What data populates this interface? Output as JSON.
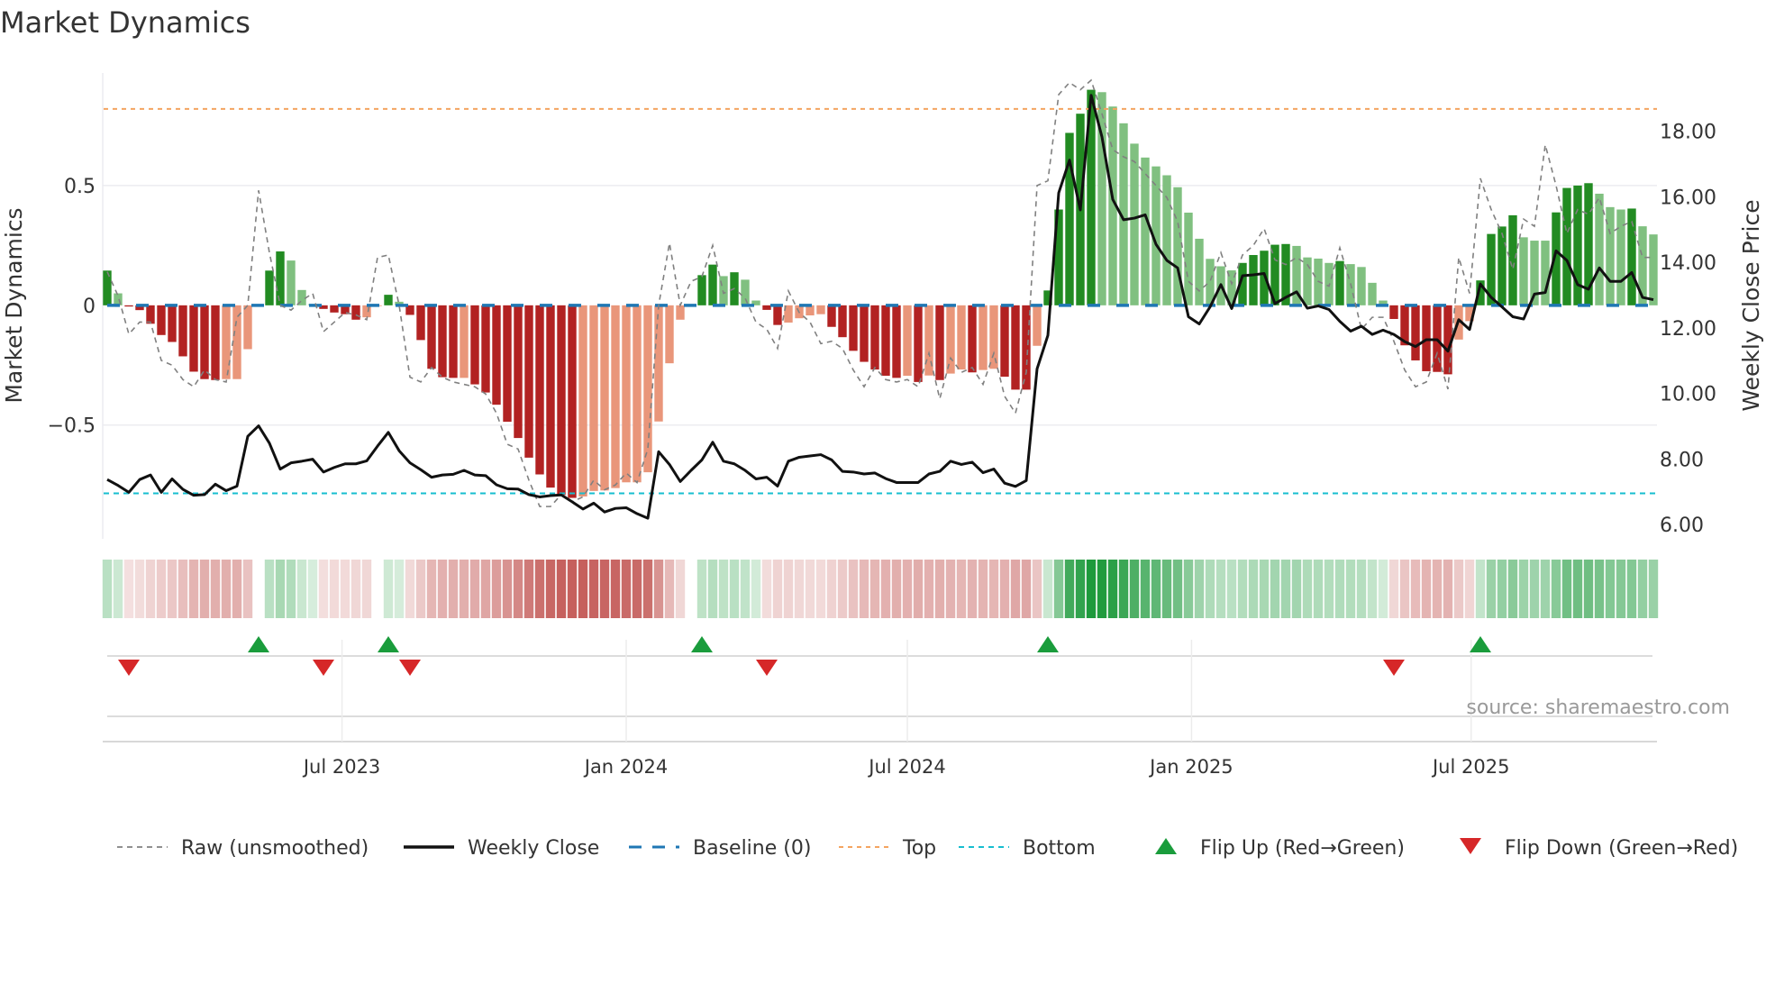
{
  "title": "Market Dynamics",
  "source": "source: sharemaestro.com",
  "chart_data": {
    "type": "bar",
    "title": "Market Dynamics",
    "ylabel": "Market Dynamics",
    "y2label": "Weekly Close Price",
    "start_date": "2023-01-30",
    "frequency": "weekly",
    "ylim": [
      -0.975,
      0.97
    ],
    "y2lim": [
      5.56,
      19.78
    ],
    "yticks": [
      {
        "v": 0.5,
        "label": "0.5"
      },
      {
        "v": 0,
        "label": "0"
      },
      {
        "v": -0.5,
        "label": "−0.5"
      }
    ],
    "y2ticks": [
      {
        "v": 6,
        "label": "6.00"
      },
      {
        "v": 8,
        "label": "8.00"
      },
      {
        "v": 10,
        "label": "10.00"
      },
      {
        "v": 12,
        "label": "12.00"
      },
      {
        "v": 14,
        "label": "14.00"
      },
      {
        "v": 16,
        "label": "16.00"
      },
      {
        "v": 18,
        "label": "18.00"
      }
    ],
    "xticks": [
      {
        "date": "2023-07-01",
        "label": "Jul 2023"
      },
      {
        "date": "2024-01-01",
        "label": "Jan 2024"
      },
      {
        "date": "2024-07-01",
        "label": "Jul 2024"
      },
      {
        "date": "2025-01-01",
        "label": "Jan 2025"
      },
      {
        "date": "2025-07-01",
        "label": "Jul 2025"
      }
    ],
    "top_level": 0.82,
    "bottom_level": -0.785,
    "baseline": 0,
    "colors": {
      "dg": "#228b22",
      "lg": "#80c080",
      "dr": "#b22222",
      "lr": "#e9967a",
      "raw": "#808080",
      "close": "#111111",
      "baseline": "#1f77b4",
      "top": "#f4a460",
      "bottom": "#17becf",
      "flip_up": "#1a9c3c",
      "flip_down": "#d62728",
      "strip_green": "#1e9a3c",
      "strip_red": "#c0504d"
    },
    "smoothed": [
      0.145,
      0.05,
      -0.005,
      -0.02,
      -0.077,
      -0.124,
      -0.153,
      -0.213,
      -0.277,
      -0.308,
      -0.312,
      -0.308,
      -0.308,
      -0.183,
      0,
      0.145,
      0.225,
      0.187,
      0.064,
      0.005,
      -0.015,
      -0.03,
      -0.037,
      -0.06,
      -0.05,
      0,
      0.044,
      0.015,
      -0.04,
      -0.145,
      -0.265,
      -0.3,
      -0.303,
      -0.303,
      -0.33,
      -0.364,
      -0.415,
      -0.486,
      -0.554,
      -0.636,
      -0.706,
      -0.761,
      -0.792,
      -0.804,
      -0.798,
      -0.775,
      -0.773,
      -0.763,
      -0.739,
      -0.739,
      -0.697,
      -0.485,
      -0.242,
      -0.06,
      0,
      0.126,
      0.17,
      0.122,
      0.138,
      0.107,
      0.02,
      -0.019,
      -0.082,
      -0.072,
      -0.054,
      -0.042,
      -0.037,
      -0.09,
      -0.133,
      -0.19,
      -0.236,
      -0.268,
      -0.294,
      -0.303,
      -0.294,
      -0.32,
      -0.293,
      -0.312,
      -0.285,
      -0.268,
      -0.28,
      -0.27,
      -0.265,
      -0.298,
      -0.352,
      -0.352,
      -0.169,
      0.062,
      0.4,
      0.72,
      0.8,
      0.9,
      0.89,
      0.83,
      0.76,
      0.675,
      0.617,
      0.58,
      0.543,
      0.493,
      0.387,
      0.278,
      0.194,
      0.163,
      0.146,
      0.177,
      0.21,
      0.228,
      0.253,
      0.256,
      0.248,
      0.2,
      0.195,
      0.177,
      0.185,
      0.172,
      0.16,
      0.094,
      0.02,
      -0.057,
      -0.167,
      -0.23,
      -0.275,
      -0.278,
      -0.288,
      -0.143,
      -0.066,
      0.104,
      0.298,
      0.329,
      0.376,
      0.284,
      0.27,
      0.27,
      0.388,
      0.49,
      0.5,
      0.51,
      0.466,
      0.41,
      0.4,
      0.404,
      0.33,
      0.296
    ],
    "bar_color": [
      "dg",
      "lg",
      "dr",
      "dr",
      "dr",
      "dr",
      "dr",
      "dr",
      "dr",
      "dr",
      "dr",
      "lr",
      "lr",
      "lr",
      "lg",
      "dg",
      "dg",
      "lg",
      "lg",
      "lg",
      "dr",
      "dr",
      "dr",
      "dr",
      "lr",
      "lr",
      "dg",
      "lg",
      "dr",
      "dr",
      "dr",
      "dr",
      "dr",
      "lr",
      "dr",
      "dr",
      "dr",
      "dr",
      "dr",
      "dr",
      "dr",
      "dr",
      "dr",
      "dr",
      "lr",
      "lr",
      "lr",
      "lr",
      "lr",
      "lr",
      "lr",
      "lr",
      "lr",
      "lr",
      "lr",
      "dg",
      "dg",
      "lg",
      "dg",
      "lg",
      "lg",
      "dr",
      "dr",
      "lr",
      "lr",
      "lr",
      "lr",
      "dr",
      "dr",
      "dr",
      "dr",
      "dr",
      "dr",
      "dr",
      "lr",
      "dr",
      "lr",
      "dr",
      "lr",
      "lr",
      "dr",
      "lr",
      "lr",
      "dr",
      "dr",
      "dr",
      "lr",
      "dg",
      "dg",
      "dg",
      "dg",
      "dg",
      "lg",
      "lg",
      "lg",
      "lg",
      "lg",
      "lg",
      "lg",
      "lg",
      "lg",
      "lg",
      "lg",
      "lg",
      "lg",
      "dg",
      "dg",
      "dg",
      "dg",
      "dg",
      "lg",
      "lg",
      "lg",
      "lg",
      "dg",
      "lg",
      "lg",
      "lg",
      "lg",
      "dr",
      "dr",
      "dr",
      "dr",
      "dr",
      "dr",
      "lr",
      "lr",
      "dg",
      "dg",
      "dg",
      "dg",
      "lg",
      "lg",
      "lg",
      "dg",
      "dg",
      "dg",
      "dg",
      "lg",
      "lg",
      "lg",
      "dg",
      "lg",
      "lg"
    ],
    "raw": [
      0.14,
      0.04,
      -0.12,
      -0.07,
      -0.07,
      -0.23,
      -0.25,
      -0.31,
      -0.34,
      -0.27,
      -0.31,
      -0.32,
      -0.05,
      0.0,
      0.48,
      0.22,
      0.0,
      -0.02,
      0.02,
      0.05,
      -0.11,
      -0.07,
      -0.03,
      -0.04,
      -0.06,
      0.2,
      0.21,
      0.0,
      -0.3,
      -0.32,
      -0.26,
      -0.3,
      -0.32,
      -0.33,
      -0.34,
      -0.37,
      -0.45,
      -0.58,
      -0.6,
      -0.73,
      -0.84,
      -0.84,
      -0.79,
      -0.82,
      -0.8,
      -0.73,
      -0.77,
      -0.75,
      -0.7,
      -0.74,
      -0.6,
      0.0,
      0.26,
      0.0,
      0.1,
      0.12,
      0.25,
      0.05,
      0.07,
      0.03,
      -0.07,
      -0.1,
      -0.18,
      0.06,
      -0.03,
      -0.07,
      -0.16,
      -0.15,
      -0.18,
      -0.27,
      -0.34,
      -0.26,
      -0.31,
      -0.32,
      -0.31,
      -0.34,
      -0.2,
      -0.39,
      -0.22,
      -0.28,
      -0.26,
      -0.33,
      -0.2,
      -0.38,
      -0.45,
      -0.28,
      0.5,
      0.52,
      0.88,
      0.93,
      0.9,
      0.94,
      0.8,
      0.65,
      0.62,
      0.6,
      0.55,
      0.5,
      0.45,
      0.35,
      0.1,
      0.06,
      0.1,
      0.22,
      0.09,
      0.21,
      0.25,
      0.32,
      0.19,
      0.17,
      0.2,
      0.17,
      0.1,
      0.08,
      0.24,
      0.09,
      -0.1,
      -0.05,
      -0.05,
      -0.15,
      -0.27,
      -0.34,
      -0.32,
      -0.2,
      -0.35,
      0.2,
      0.05,
      0.53,
      0.4,
      0.3,
      0.15,
      0.36,
      0.33,
      0.67,
      0.5,
      0.3,
      0.4,
      0.38,
      0.45,
      0.3,
      0.33,
      0.35,
      0.2,
      0.2
    ],
    "close": [
      7.37,
      7.19,
      6.98,
      7.37,
      7.51,
      6.98,
      7.39,
      7.07,
      6.89,
      6.91,
      7.23,
      7.03,
      7.17,
      8.69,
      9.01,
      8.48,
      7.69,
      7.88,
      7.93,
      7.99,
      7.6,
      7.74,
      7.85,
      7.85,
      7.94,
      8.39,
      8.81,
      8.25,
      7.88,
      7.67,
      7.44,
      7.51,
      7.53,
      7.65,
      7.51,
      7.49,
      7.21,
      7.09,
      7.08,
      6.91,
      6.84,
      6.88,
      6.9,
      6.69,
      6.47,
      6.65,
      6.38,
      6.49,
      6.51,
      6.33,
      6.19,
      8.22,
      7.83,
      7.31,
      7.65,
      7.97,
      8.51,
      7.93,
      7.85,
      7.65,
      7.39,
      7.44,
      7.17,
      7.93,
      8.05,
      8.09,
      8.13,
      7.97,
      7.62,
      7.6,
      7.54,
      7.57,
      7.4,
      7.28,
      7.28,
      7.28,
      7.54,
      7.62,
      7.93,
      7.83,
      7.9,
      7.58,
      7.69,
      7.26,
      7.16,
      7.34,
      10.75,
      11.77,
      16.12,
      17.12,
      15.6,
      19.1,
      17.83,
      15.92,
      15.3,
      15.35,
      15.45,
      14.55,
      14.06,
      13.83,
      12.34,
      12.12,
      12.64,
      13.32,
      12.59,
      13.59,
      13.62,
      13.66,
      12.74,
      12.93,
      13.1,
      12.6,
      12.67,
      12.56,
      12.2,
      11.9,
      12.05,
      11.8,
      11.93,
      11.8,
      11.58,
      11.43,
      11.64,
      11.64,
      11.29,
      12.25,
      11.95,
      13.34,
      12.93,
      12.64,
      12.34,
      12.27,
      13.03,
      13.08,
      14.35,
      14.06,
      13.32,
      13.18,
      13.83,
      13.42,
      13.42,
      13.69,
      12.93,
      12.86
    ],
    "flip_up": [
      14,
      26,
      55,
      87,
      127
    ],
    "flip_down": [
      2,
      20,
      28,
      61,
      119
    ],
    "legend": {
      "placement": "bottom",
      "items": [
        {
          "key": "raw",
          "label": "Raw (unsmoothed)"
        },
        {
          "key": "close",
          "label": "Weekly Close"
        },
        {
          "key": "baseline",
          "label": "Baseline (0)"
        },
        {
          "key": "top",
          "label": "Top"
        },
        {
          "key": "bottom",
          "label": "Bottom"
        },
        {
          "key": "flip_up",
          "label": "Flip Up (Red→Green)"
        },
        {
          "key": "flip_down",
          "label": "Flip Down (Green→Red)"
        }
      ]
    }
  }
}
